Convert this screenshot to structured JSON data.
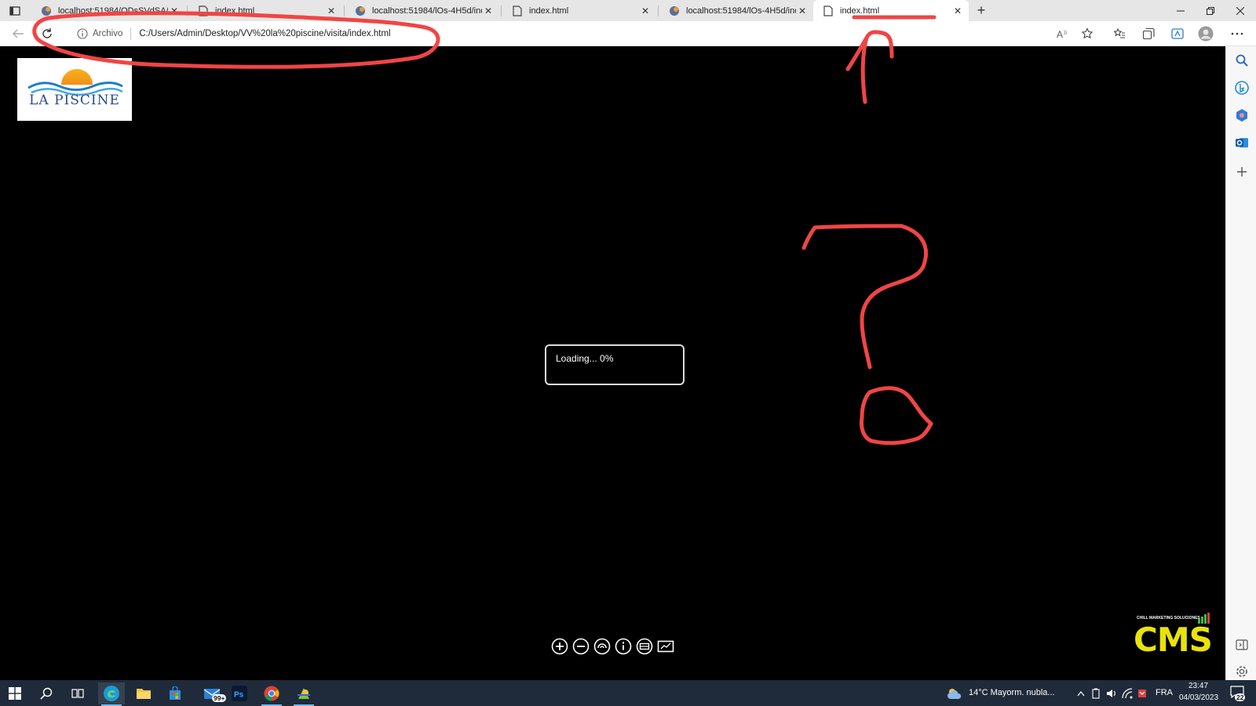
{
  "browser": {
    "tabs": [
      {
        "title": "localhost:51984/ODsSVdSA/inde",
        "favicon": "app-favicon"
      },
      {
        "title": "index.html",
        "favicon": "file-icon"
      },
      {
        "title": "localhost:51984/lOs-4H5d/inde",
        "favicon": "app-favicon"
      },
      {
        "title": "index.html",
        "favicon": "file-icon"
      },
      {
        "title": "localhost:51984/lOs-4H5d/inde",
        "favicon": "app-favicon"
      },
      {
        "title": "index.html",
        "favicon": "file-icon",
        "active": true
      }
    ],
    "address": {
      "site_label": "Archivo",
      "url": "C:/Users/Admin/Desktop/VV%20la%20piscine/visita/index.html"
    }
  },
  "page": {
    "logo_text": "LA PISCINE",
    "loading_text": "Loading... 0%",
    "controls": [
      "zoom-in-icon",
      "zoom-out-icon",
      "rotate-icon",
      "info-icon",
      "fullscreen-icon",
      "map-icon"
    ],
    "brand_tag": "CHILL MARKETING SOLUCIONES",
    "brand_word": "CMS"
  },
  "taskbar": {
    "weather": "14°C  Mayorm. nubla...",
    "lang": "FRA",
    "time": "23:47",
    "date": "04/03/2023",
    "mail_badge": "99+",
    "notifications": "22"
  },
  "colors": {
    "annotation": "#f04545",
    "taskbar": "#1f2b3a",
    "brand_yellow": "#e8e30a"
  }
}
